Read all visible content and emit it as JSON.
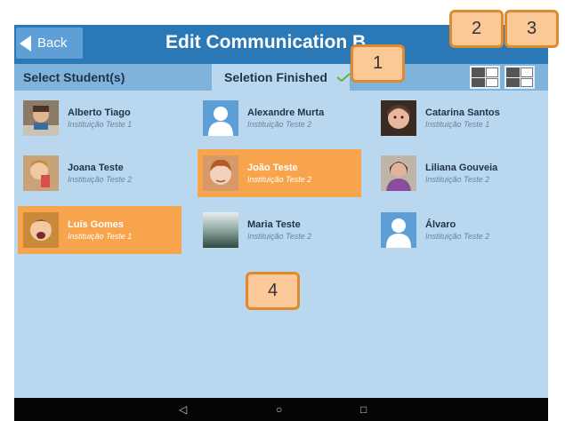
{
  "header": {
    "back_label": "Back",
    "title": "Edit Communication B"
  },
  "tabs": {
    "select_students": "Select Student(s)",
    "selection_finished": "Seletion Finished"
  },
  "students": [
    {
      "name": "Alberto Tiago",
      "institution": "Instituição Teste 1",
      "selected": false,
      "avatar": "photo-boy-desk"
    },
    {
      "name": "Alexandre Murta",
      "institution": "Instituição Teste 2",
      "selected": false,
      "avatar": "default-silhouette"
    },
    {
      "name": "Catarina Santos",
      "institution": "Instituição Teste 1",
      "selected": false,
      "avatar": "photo-girl"
    },
    {
      "name": "Joana Teste",
      "institution": "Instituição Teste 2",
      "selected": false,
      "avatar": "photo-child"
    },
    {
      "name": "João Teste",
      "institution": "Instituição Teste 2",
      "selected": true,
      "avatar": "photo-boy-red-hair"
    },
    {
      "name": "Liliana Gouveia",
      "institution": "Instituição Teste 2",
      "selected": false,
      "avatar": "photo-woman"
    },
    {
      "name": "Luís Gomes",
      "institution": "Instituição Teste 1",
      "selected": true,
      "avatar": "photo-boy-shouting"
    },
    {
      "name": "Maria Teste",
      "institution": "Instituição Teste 2",
      "selected": false,
      "avatar": "photo-blurred"
    },
    {
      "name": "Álvaro",
      "institution": "Instituição Teste 2",
      "selected": false,
      "avatar": "default-silhouette"
    }
  ],
  "callouts": [
    "1",
    "2",
    "3",
    "4"
  ],
  "nav": {
    "back": "◁",
    "home": "○",
    "recents": "□"
  },
  "colors": {
    "topbar": "#2a78b5",
    "background": "#b9d7ee",
    "selected": "#f8a44c",
    "callout_fill": "#fac997",
    "callout_border": "#e08a2f"
  }
}
